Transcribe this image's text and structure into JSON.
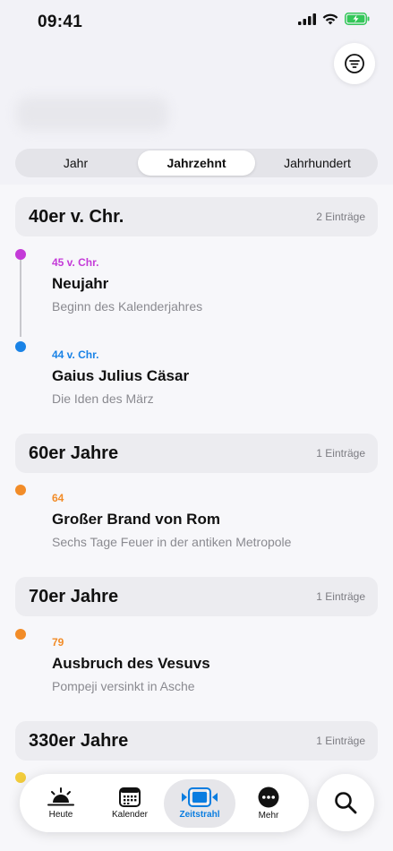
{
  "status_bar": {
    "time": "09:41"
  },
  "segments": [
    {
      "label": "Jahr",
      "active": false
    },
    {
      "label": "Jahrzehnt",
      "active": true
    },
    {
      "label": "Jahrhundert",
      "active": false
    }
  ],
  "sections": [
    {
      "title": "40er v. Chr.",
      "count": "2 Einträge",
      "entries": [
        {
          "year": "45 v. Chr.",
          "title": "Neujahr",
          "subtitle": "Beginn des Kalenderjahres",
          "color": "#c43bd8"
        },
        {
          "year": "44 v. Chr.",
          "title": "Gaius Julius Cäsar",
          "subtitle": "Die Iden des März",
          "color": "#1a83e6"
        }
      ]
    },
    {
      "title": "60er Jahre",
      "count": "1 Einträge",
      "entries": [
        {
          "year": "64",
          "title": "Großer Brand von Rom",
          "subtitle": "Sechs Tage Feuer in der antiken Metropole",
          "color": "#f28c28"
        }
      ]
    },
    {
      "title": "70er Jahre",
      "count": "1 Einträge",
      "entries": [
        {
          "year": "79",
          "title": "Ausbruch des Vesuvs",
          "subtitle": "Pompeji versinkt in Asche",
          "color": "#f28c28"
        }
      ]
    },
    {
      "title": "330er Jahre",
      "count": "1 Einträge",
      "entries": [
        {
          "color": "#f2cc3c"
        }
      ]
    }
  ],
  "tabbar": [
    {
      "label": "Heute",
      "icon": "sunrise-icon",
      "active": false
    },
    {
      "label": "Kalender",
      "icon": "calendar-icon",
      "active": false
    },
    {
      "label": "Zeitstrahl",
      "icon": "timeline-icon",
      "active": true
    },
    {
      "label": "Mehr",
      "icon": "more-icon",
      "active": false
    }
  ],
  "colors": {
    "accent": "#0a7de0",
    "battery": "#34c759"
  }
}
